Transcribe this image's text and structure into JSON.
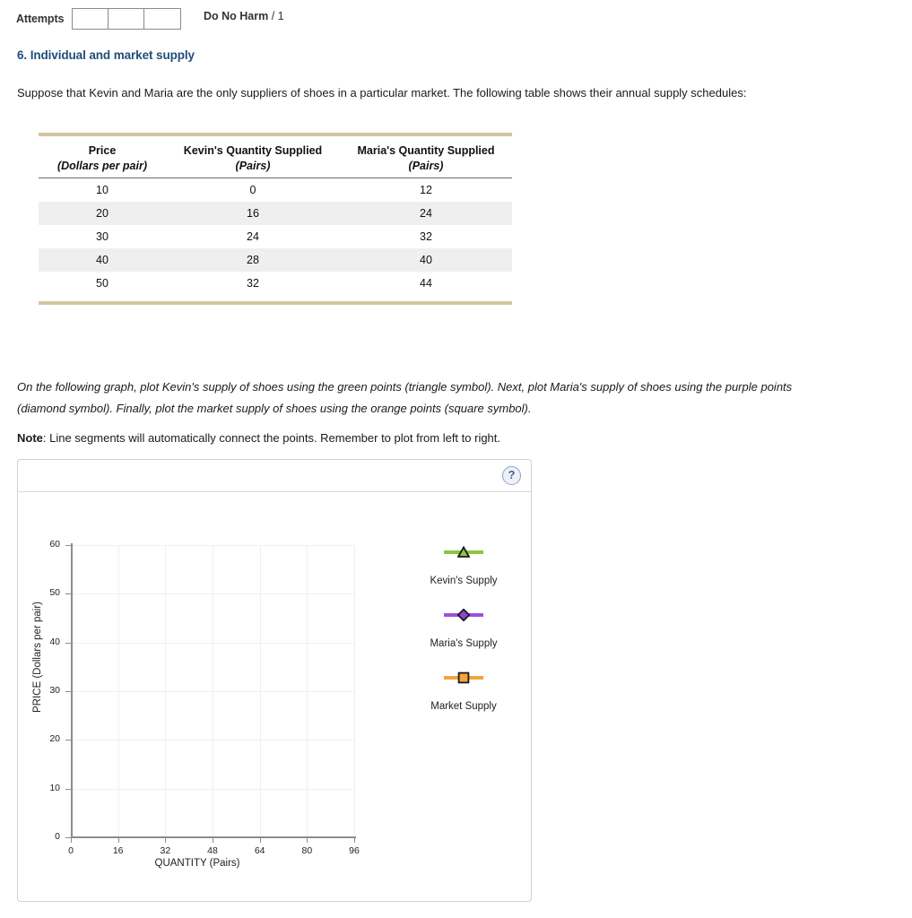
{
  "header": {
    "attempts_label": "Attempts",
    "attempt_boxes": [
      "",
      "",
      ""
    ],
    "score_label": "Do No Harm",
    "score_separator": " / ",
    "score_value": "1"
  },
  "question": {
    "heading": "6. Individual and market supply",
    "intro": "Suppose that Kevin and Maria are the only suppliers of shoes in a particular market. The following table shows their annual supply schedules:",
    "plot_instructions": "On the following graph, plot Kevin's supply of shoes using the green points (triangle symbol). Next, plot Maria's supply of shoes using the purple points (diamond symbol). Finally, plot the market supply of shoes using the orange points (square symbol).",
    "note_bold": "Note",
    "note_text": ": Line segments will automatically connect the points. Remember to plot from left to right."
  },
  "table": {
    "headers_main": [
      "Price",
      "Kevin's Quantity Supplied",
      "Maria's Quantity Supplied"
    ],
    "headers_unit": [
      "(Dollars per pair)",
      "(Pairs)",
      "(Pairs)"
    ],
    "rows": [
      [
        "10",
        "0",
        "12"
      ],
      [
        "20",
        "16",
        "24"
      ],
      [
        "30",
        "24",
        "32"
      ],
      [
        "40",
        "28",
        "40"
      ],
      [
        "50",
        "32",
        "44"
      ]
    ]
  },
  "graph": {
    "help_icon": "?",
    "help_glyph": "?"
  },
  "chart_data": {
    "type": "line",
    "title": "",
    "xlabel": "QUANTITY (Pairs)",
    "ylabel": "PRICE (Dollars per pair)",
    "xlim": [
      0,
      96
    ],
    "ylim": [
      0,
      60
    ],
    "xticks": [
      0,
      16,
      32,
      48,
      64,
      80,
      96
    ],
    "yticks": [
      0,
      10,
      20,
      30,
      40,
      50,
      60
    ],
    "xtick_labels": [
      "0",
      "16",
      "32",
      "48",
      "64",
      "80",
      "96"
    ],
    "ytick_labels": [
      "0",
      "10",
      "20",
      "30",
      "40",
      "50",
      "60"
    ],
    "grid": true,
    "legend_position": "right",
    "series": [
      {
        "name": "Kevin's Supply",
        "marker": "triangle",
        "color": "#8DC63F",
        "marker_fill": "#8DC63F",
        "marker_edge": "#1a1a1a",
        "x": [],
        "y": [],
        "plotted": false
      },
      {
        "name": "Maria's Supply",
        "marker": "diamond",
        "color": "#9B51E0",
        "marker_fill": "#8E44D0",
        "marker_edge": "#1a1a1a",
        "x": [],
        "y": [],
        "plotted": false
      },
      {
        "name": "Market Supply",
        "marker": "square",
        "color": "#F5A33C",
        "marker_fill": "#F5A33C",
        "marker_edge": "#1a1a1a",
        "x": [],
        "y": [],
        "plotted": false
      }
    ]
  }
}
